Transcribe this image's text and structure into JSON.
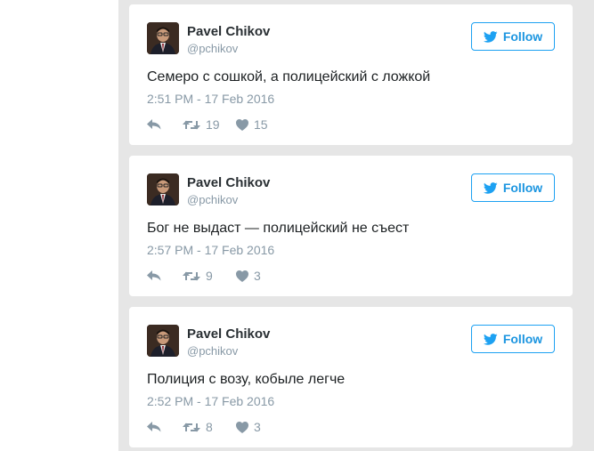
{
  "tweets": [
    {
      "author_name": "Pavel Chikov",
      "author_handle": "@pchikov",
      "follow_label": "Follow",
      "text": "Семеро с сошкой, а полицейский с ложкой",
      "timestamp": "2:51 PM - 17 Feb 2016",
      "retweets": "19",
      "likes": "15"
    },
    {
      "author_name": "Pavel Chikov",
      "author_handle": "@pchikov",
      "follow_label": "Follow",
      "text": "Бог не выдаст — полицейский не съест",
      "timestamp": "2:57 PM - 17 Feb 2016",
      "retweets": "9",
      "likes": "3"
    },
    {
      "author_name": "Pavel Chikov",
      "author_handle": "@pchikov",
      "follow_label": "Follow",
      "text": "Полиция с возу, кобыле легче",
      "timestamp": "2:52 PM - 17 Feb 2016",
      "retweets": "8",
      "likes": "3"
    }
  ],
  "icons": {
    "follow": "twitter-bird-icon",
    "reply": "reply-icon",
    "retweet": "retweet-icon",
    "like": "heart-icon"
  },
  "colors": {
    "accent": "#1da1f2",
    "follow_text": "#1b95e0",
    "muted": "#8899a6",
    "name": "#292f33",
    "body_text": "#1c2022",
    "background": "#e6e6e6",
    "card": "#ffffff"
  }
}
